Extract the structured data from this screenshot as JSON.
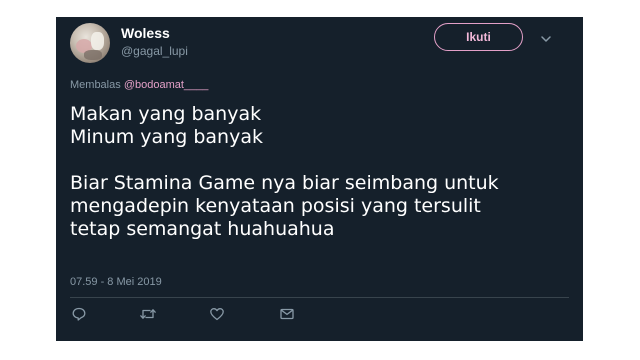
{
  "tweet": {
    "display_name": "Woless",
    "handle": "@gagal_lupi",
    "follow_label": "Ikuti",
    "reply_prefix": "Membalas",
    "reply_mention": "@bodoamat____",
    "text_lines": [
      "Makan yang banyak",
      "Minum yang banyak",
      "",
      "Biar Stamina Game nya biar seimbang untuk",
      "mengadepin kenyataan posisi yang tersulit",
      "tetap semangat huahuahua"
    ],
    "timestamp": "07.59 - 8 Mei 2019"
  },
  "icons": {
    "more": "chevron-down-icon",
    "reply": "reply-icon",
    "retweet": "retweet-icon",
    "like": "heart-icon",
    "dm": "envelope-icon"
  },
  "colors": {
    "background": "#15202b",
    "accent": "#e3a0c8",
    "secondary_text": "#8899a6",
    "divider": "#38444d"
  }
}
